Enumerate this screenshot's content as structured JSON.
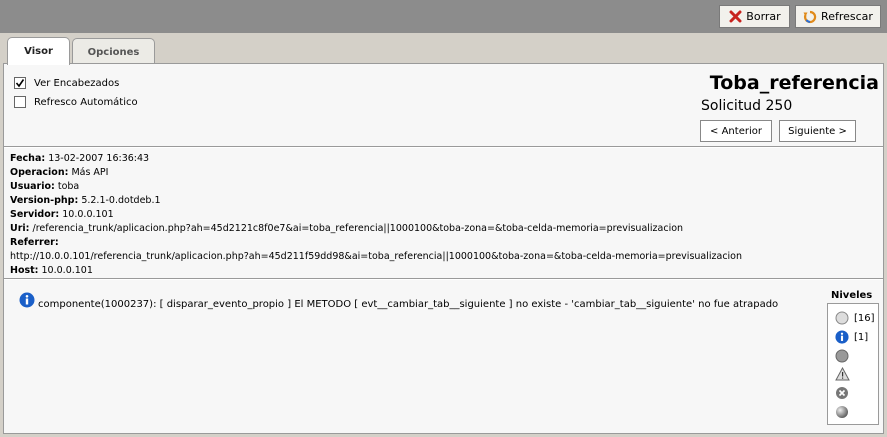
{
  "toolbar": {
    "borrar_label": "Borrar",
    "refrescar_label": "Refrescar"
  },
  "tabs": [
    {
      "label": "Visor"
    },
    {
      "label": "Opciones"
    }
  ],
  "options": {
    "ver_encabezados": "Ver Encabezados",
    "refresco_automatico": "Refresco Automático"
  },
  "header": {
    "title": "Toba_referencia",
    "solicitud": "Solicitud 250"
  },
  "nav": {
    "anterior": "< Anterior",
    "siguiente": "Siguiente >"
  },
  "info": {
    "fecha_label": "Fecha:",
    "fecha": "13-02-2007 16:36:43",
    "operacion_label": "Operacion:",
    "operacion": "Más API",
    "usuario_label": "Usuario:",
    "usuario": "toba",
    "version_label": "Version-php:",
    "version": "5.2.1-0.dotdeb.1",
    "servidor_label": "Servidor:",
    "servidor": "10.0.0.101",
    "uri_label": "Uri:",
    "uri": "/referencia_trunk/aplicacion.php?ah=45d2121c8f0e7&ai=toba_referencia||1000100&toba-zona=&toba-celda-memoria=previsualizacion",
    "referrer_label": "Referrer:",
    "referrer": "http://10.0.0.101/referencia_trunk/aplicacion.php?ah=45d211f59dd98&ai=toba_referencia||1000100&toba-zona=&toba-celda-memoria=previsualizacion",
    "host_label": "Host:",
    "host": "10.0.0.101"
  },
  "message": "componente(1000237): [ disparar_evento_propio ] El METODO [ evt__cambiar_tab__siguiente ] no existe - 'cambiar_tab__siguiente' no fue atrapado",
  "niveles": {
    "title": "Niveles",
    "items": [
      {
        "icon": "debug-icon",
        "count": "[16]"
      },
      {
        "icon": "info-icon",
        "count": "[1]"
      },
      {
        "icon": "notice-icon",
        "count": ""
      },
      {
        "icon": "warning-icon",
        "count": ""
      },
      {
        "icon": "error-icon",
        "count": ""
      },
      {
        "icon": "critical-icon",
        "count": ""
      }
    ]
  },
  "colors": {
    "topbar": "#8c8c8c",
    "panel": "#f7f7f7",
    "info_blue": "#1a5fc8"
  }
}
